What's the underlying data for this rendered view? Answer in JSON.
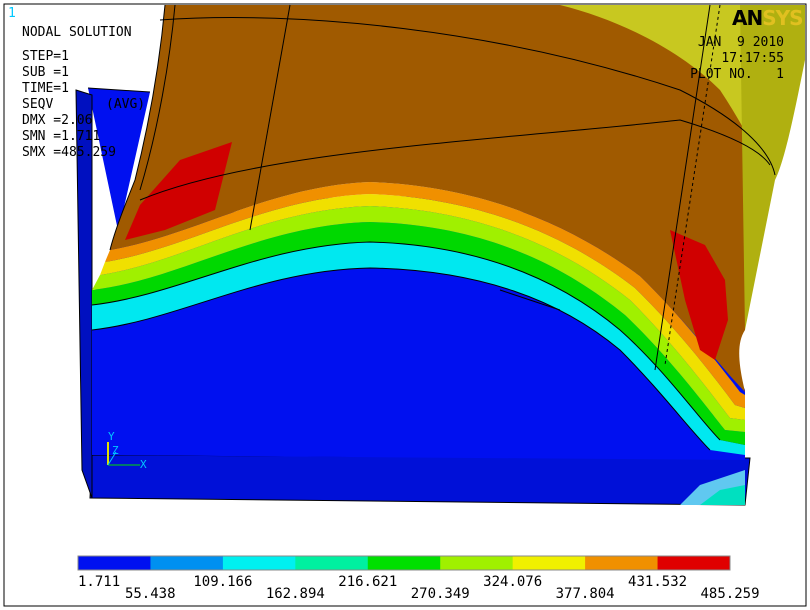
{
  "window_number": "1",
  "header": {
    "title": "NODAL SOLUTION",
    "step": "STEP=1",
    "sub": "SUB =1",
    "time": "TIME=1",
    "seqv": "SEQV",
    "avg": "(AVG)",
    "dmx": "DMX =2.06",
    "smn": "SMN =1.711",
    "smx": "SMX =485.259"
  },
  "info": {
    "date": "JAN  9 2010",
    "time": "17:17:55",
    "plot_no": "PLOT NO.   1"
  },
  "logo": {
    "an": "AN",
    "sys": "SYS"
  },
  "triad": {
    "y": "Y",
    "z": "Z",
    "x": "X"
  },
  "legend": {
    "colors": [
      "#0010f0",
      "#0090f0",
      "#00f0f0",
      "#00f0a0",
      "#00e000",
      "#a0f000",
      "#f0f000",
      "#f09000",
      "#e00000"
    ],
    "values": [
      "1.711",
      "55.438",
      "109.166",
      "162.894",
      "216.621",
      "270.349",
      "324.076",
      "377.804",
      "431.532",
      "485.259"
    ]
  }
}
